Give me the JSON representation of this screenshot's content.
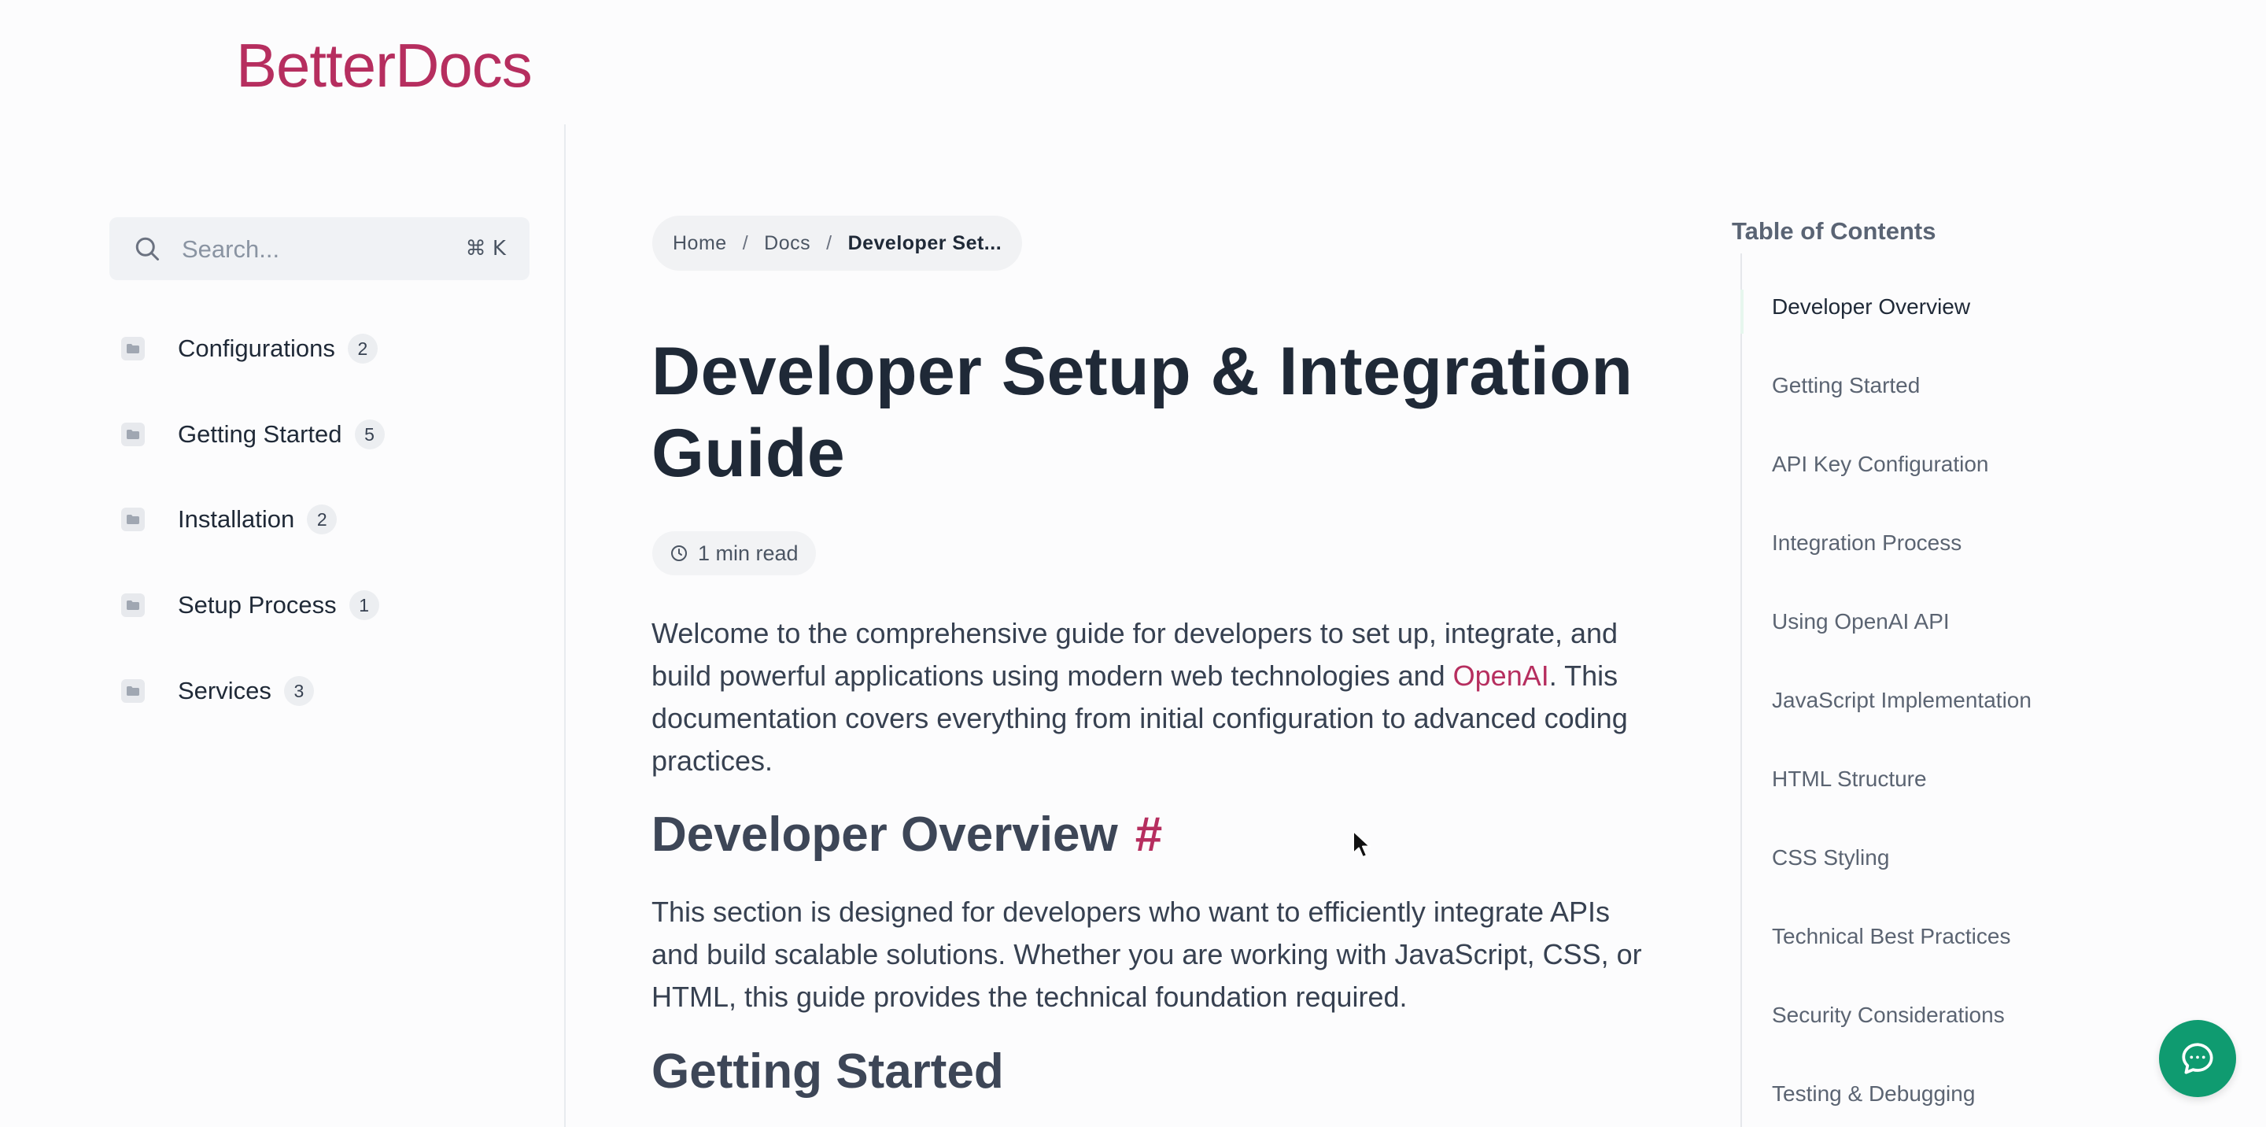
{
  "brand": {
    "logo_text": "BetterDocs",
    "accent_color": "#b62e5f"
  },
  "search": {
    "placeholder": "Search...",
    "shortcut": "⌘ K"
  },
  "sidebar": {
    "items": [
      {
        "label": "Configurations",
        "count": "2"
      },
      {
        "label": "Getting Started",
        "count": "5"
      },
      {
        "label": "Installation",
        "count": "2"
      },
      {
        "label": "Setup Process",
        "count": "1"
      },
      {
        "label": "Services",
        "count": "3"
      }
    ]
  },
  "breadcrumb": {
    "home": "Home",
    "separator1": "/",
    "docs": "Docs",
    "separator2": "/",
    "current": "Developer Set..."
  },
  "article": {
    "title": "Developer Setup & Integration Guide",
    "read_time": "1 min read",
    "intro_before_link": "Welcome to the comprehensive guide for developers to set up, integrate, and build powerful applications using modern web technologies and ",
    "intro_link": "OpenAI",
    "intro_after_link": ". This documentation covers everything from initial configuration to advanced coding practices.",
    "section1_heading": "Developer Overview",
    "section1_anchor": "#",
    "section1_text": "This section is designed for developers who want to efficiently integrate APIs and build scalable solutions. Whether you are working with JavaScript, CSS, or HTML, this guide provides the technical foundation required.",
    "section2_heading": "Getting Started"
  },
  "toc": {
    "title": "Table of Contents",
    "items": [
      "Developer Overview",
      "Getting Started",
      "API Key Configuration",
      "Integration Process",
      "Using OpenAI API",
      "JavaScript Implementation",
      "HTML Structure",
      "CSS Styling",
      "Technical Best Practices",
      "Security Considerations",
      "Testing & Debugging"
    ]
  },
  "chat": {
    "icon": "chat-bubble-icon",
    "color": "#0f9b70"
  }
}
